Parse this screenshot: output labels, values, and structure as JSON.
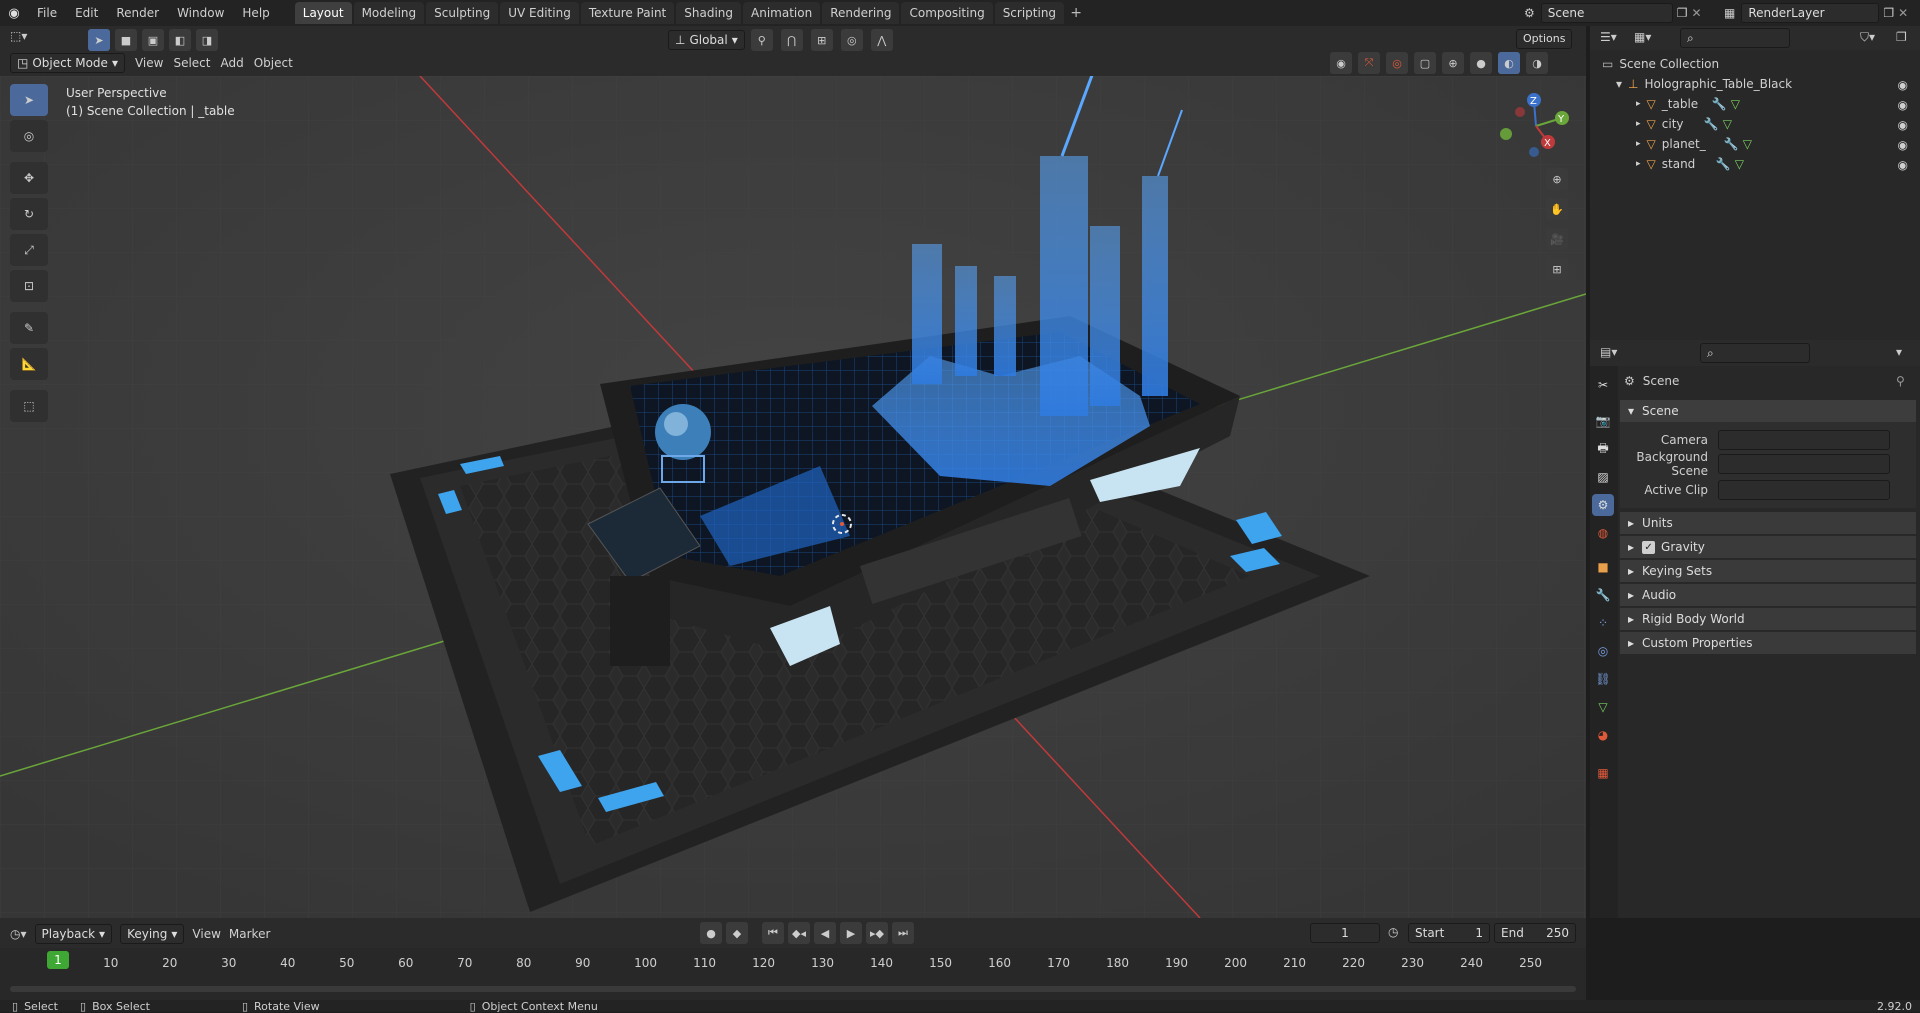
{
  "top_menu": [
    "File",
    "Edit",
    "Render",
    "Window",
    "Help"
  ],
  "workspace_tabs": [
    {
      "label": "Layout",
      "active": true
    },
    {
      "label": "Modeling",
      "active": false
    },
    {
      "label": "Sculpting",
      "active": false
    },
    {
      "label": "UV Editing",
      "active": false
    },
    {
      "label": "Texture Paint",
      "active": false
    },
    {
      "label": "Shading",
      "active": false
    },
    {
      "label": "Animation",
      "active": false
    },
    {
      "label": "Rendering",
      "active": false
    },
    {
      "label": "Compositing",
      "active": false
    },
    {
      "label": "Scripting",
      "active": false
    }
  ],
  "scene_name": "Scene",
  "render_layer": "RenderLayer",
  "viewport_header": {
    "mode": "Object Mode",
    "menu": [
      "View",
      "Select",
      "Add",
      "Object"
    ],
    "transform_orientation": "Global",
    "options_label": "Options"
  },
  "viewport": {
    "perspective_label": "User Perspective",
    "collection_label": "(1) Scene Collection | _table",
    "gizmo_labels": [
      "Z",
      "Y",
      "X"
    ]
  },
  "outliner": {
    "root": "Scene Collection",
    "collection": "Holographic_Table_Black",
    "objects": [
      "_table",
      "city",
      "planet_",
      "stand"
    ]
  },
  "properties": {
    "breadcrumb": "Scene",
    "panel_title": "Scene",
    "fields": [
      {
        "label": "Camera",
        "value": ""
      },
      {
        "label": "Background Scene",
        "value": ""
      },
      {
        "label": "Active Clip",
        "value": ""
      }
    ],
    "subpanels": [
      {
        "label": "Units",
        "checkbox": false
      },
      {
        "label": "Gravity",
        "checkbox": true
      },
      {
        "label": "Keying Sets",
        "checkbox": false
      },
      {
        "label": "Audio",
        "checkbox": false
      },
      {
        "label": "Rigid Body World",
        "checkbox": false
      },
      {
        "label": "Custom Properties",
        "checkbox": false
      }
    ]
  },
  "timeline": {
    "menus": [
      "Playback",
      "Keying",
      "View",
      "Marker"
    ],
    "current_frame": "1",
    "start_label": "Start",
    "start": "1",
    "end_label": "End",
    "end": "250",
    "ticks": [
      "1",
      "10",
      "20",
      "30",
      "40",
      "50",
      "60",
      "70",
      "80",
      "90",
      "100",
      "110",
      "120",
      "130",
      "140",
      "150",
      "160",
      "170",
      "180",
      "190",
      "200",
      "210",
      "220",
      "230",
      "240",
      "250"
    ]
  },
  "status_bar": {
    "items": [
      "Select",
      "Box Select",
      "Rotate View",
      "Object Context Menu"
    ],
    "version": "2.92.0"
  },
  "colors": {
    "accent": "#4b6a9b",
    "active_frame": "#3fa835",
    "hologram": "#3d8fe6",
    "axis_x": "#c0393b",
    "axis_y": "#6aa63a"
  }
}
